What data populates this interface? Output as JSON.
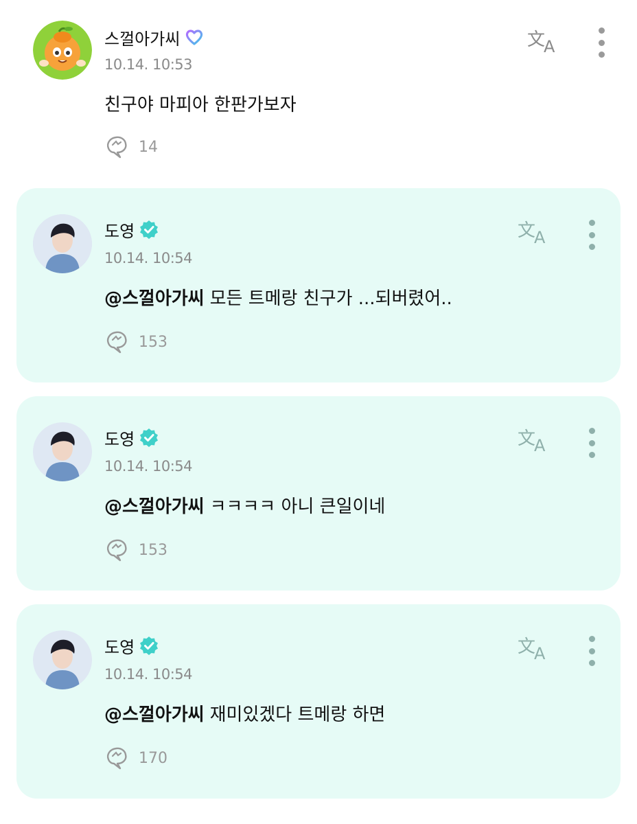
{
  "posts": [
    {
      "author": "스껄아가씨",
      "author_type": "fan",
      "badge": "membership-heart-icon",
      "time": "10.14. 10:53",
      "mention": "",
      "text": "친구야 마피아 한판가보자",
      "replies": "14"
    },
    {
      "author": "도영",
      "author_type": "artist",
      "badge": "verified-check-icon",
      "time": "10.14. 10:54",
      "mention": "@스껄아가씨",
      "text": "모든 트메랑 친구가 ...되버렸어..",
      "replies": "153"
    },
    {
      "author": "도영",
      "author_type": "artist",
      "badge": "verified-check-icon",
      "time": "10.14. 10:54",
      "mention": "@스껄아가씨",
      "text": "ㅋㅋㅋㅋ 아니 큰일이네",
      "replies": "153"
    },
    {
      "author": "도영",
      "author_type": "artist",
      "badge": "verified-check-icon",
      "time": "10.14. 10:54",
      "mention": "@스껄아가씨",
      "text": "재미있겠다 트메랑 하면",
      "replies": "170"
    }
  ],
  "colors": {
    "artist_card_bg": "#e6fbf6",
    "verified_badge": "#3fd0c9",
    "timestamp": "#8a8a8a",
    "reply_count": "#999999"
  }
}
